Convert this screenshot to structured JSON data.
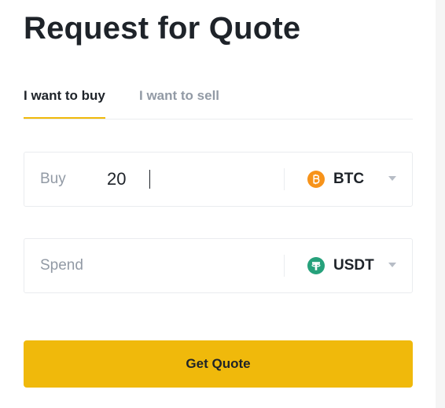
{
  "title": "Request for Quote",
  "tabs": [
    {
      "label": "I want to buy",
      "active": true
    },
    {
      "label": "I want to sell",
      "active": false
    }
  ],
  "buy_field": {
    "label": "Buy",
    "value": "20",
    "coin": {
      "name": "BTC",
      "icon": "bitcoin-icon",
      "color": "#f7931a"
    }
  },
  "spend_field": {
    "label": "Spend",
    "value": "",
    "coin": {
      "name": "USDT",
      "icon": "tether-icon",
      "color": "#26a17b"
    }
  },
  "button": {
    "label": "Get Quote"
  },
  "colors": {
    "accent": "#f0b90b",
    "text_primary": "#1e2329",
    "text_secondary": "#929aa5",
    "border": "#eaecef"
  }
}
